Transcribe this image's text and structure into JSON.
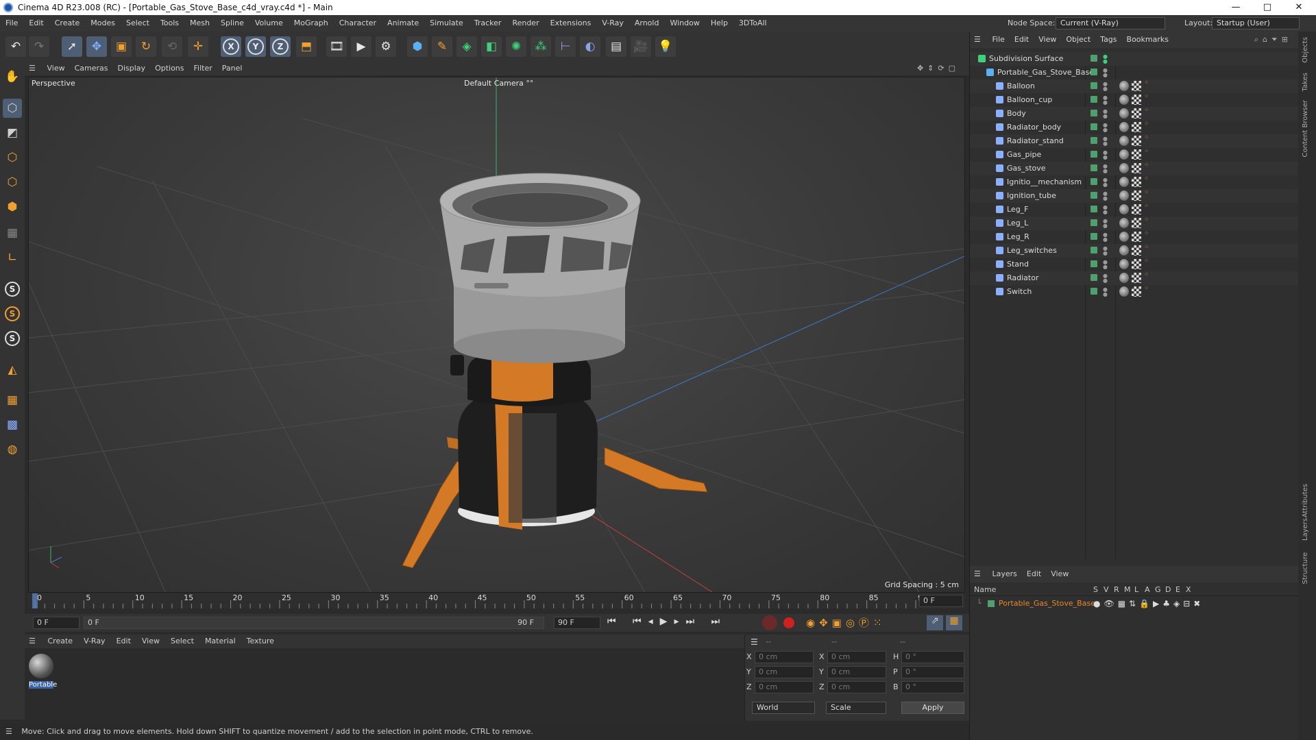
{
  "window": {
    "title": "Cinema 4D R23.008 (RC) - [Portable_Gas_Stove_Base_c4d_vray.c4d *] - Main",
    "min": "—",
    "max": "□",
    "close": "✕"
  },
  "menubar": {
    "items": [
      "File",
      "Edit",
      "Create",
      "Modes",
      "Select",
      "Tools",
      "Mesh",
      "Spline",
      "Volume",
      "MoGraph",
      "Character",
      "Animate",
      "Simulate",
      "Tracker",
      "Render",
      "Extensions",
      "V-Ray",
      "Arnold",
      "Window",
      "Help",
      "3DToAll"
    ],
    "node_space_label": "Node Space:",
    "node_space_value": "Current (V-Ray)",
    "layout_label": "Layout:",
    "layout_value": "Startup (User)"
  },
  "viewport": {
    "menu": [
      "View",
      "Cameras",
      "Display",
      "Options",
      "Filter",
      "Panel"
    ],
    "label": "Perspective",
    "camera": "Default Camera",
    "grid_spacing": "Grid Spacing : 5 cm"
  },
  "timeline": {
    "ticks": [
      "0",
      "5",
      "10",
      "15",
      "20",
      "25",
      "30",
      "35",
      "40",
      "45",
      "50",
      "55",
      "60",
      "65",
      "70",
      "75",
      "80",
      "85",
      "90"
    ],
    "current_frame": "0 F",
    "start_frame": "0 F",
    "range_start": "0 F",
    "range_end": "90 F",
    "end_frame": "90 F"
  },
  "material_manager": {
    "menu": [
      "Create",
      "V-Ray",
      "Edit",
      "View",
      "Select",
      "Material",
      "Texture"
    ],
    "materials": [
      {
        "name": "Portable"
      }
    ]
  },
  "coordinates": {
    "header": [
      "--",
      "--",
      "--"
    ],
    "rows": [
      {
        "a": "X",
        "av": "0 cm",
        "b": "X",
        "bv": "0 cm",
        "c": "H",
        "cv": "0 °"
      },
      {
        "a": "Y",
        "av": "0 cm",
        "b": "Y",
        "bv": "0 cm",
        "c": "P",
        "cv": "0 °"
      },
      {
        "a": "Z",
        "av": "0 cm",
        "b": "Z",
        "bv": "0 cm",
        "c": "B",
        "cv": "0 °"
      }
    ],
    "space": "World",
    "mode": "Scale",
    "apply": "Apply"
  },
  "status": "Move: Click and drag to move elements. Hold down SHIFT to quantize movement / add to the selection in point mode, CTRL to remove.",
  "object_manager": {
    "menu": [
      "File",
      "Edit",
      "View",
      "Object",
      "Tags",
      "Bookmarks"
    ],
    "root": "Subdivision Surface",
    "group": "Portable_Gas_Stove_Base",
    "objects": [
      "Balloon",
      "Balloon_cup",
      "Body",
      "Radiator_body",
      "Radiator_stand",
      "Gas_pipe",
      "Gas_stove",
      "Ignitio__mechanism",
      "Ignition_tube",
      "Leg_F",
      "Leg_L",
      "Leg_R",
      "Leg_switches",
      "Stand",
      "Radiator",
      "Switch"
    ]
  },
  "layer_manager": {
    "menu": [
      "Layers",
      "Edit",
      "View"
    ],
    "columns": [
      "Name",
      "S",
      "V",
      "R",
      "M",
      "L",
      "A",
      "G",
      "D",
      "E",
      "X"
    ],
    "layers": [
      {
        "name": "Portable_Gas_Stove_Base"
      }
    ]
  },
  "side_tabs": [
    "Objects",
    "Takes",
    "Content Browser",
    "Attributes",
    "Layers",
    "Structure"
  ],
  "colors": {
    "accent": "#e8882a",
    "layer_text": "#e8882a",
    "vis_green": "#4fa06e"
  }
}
